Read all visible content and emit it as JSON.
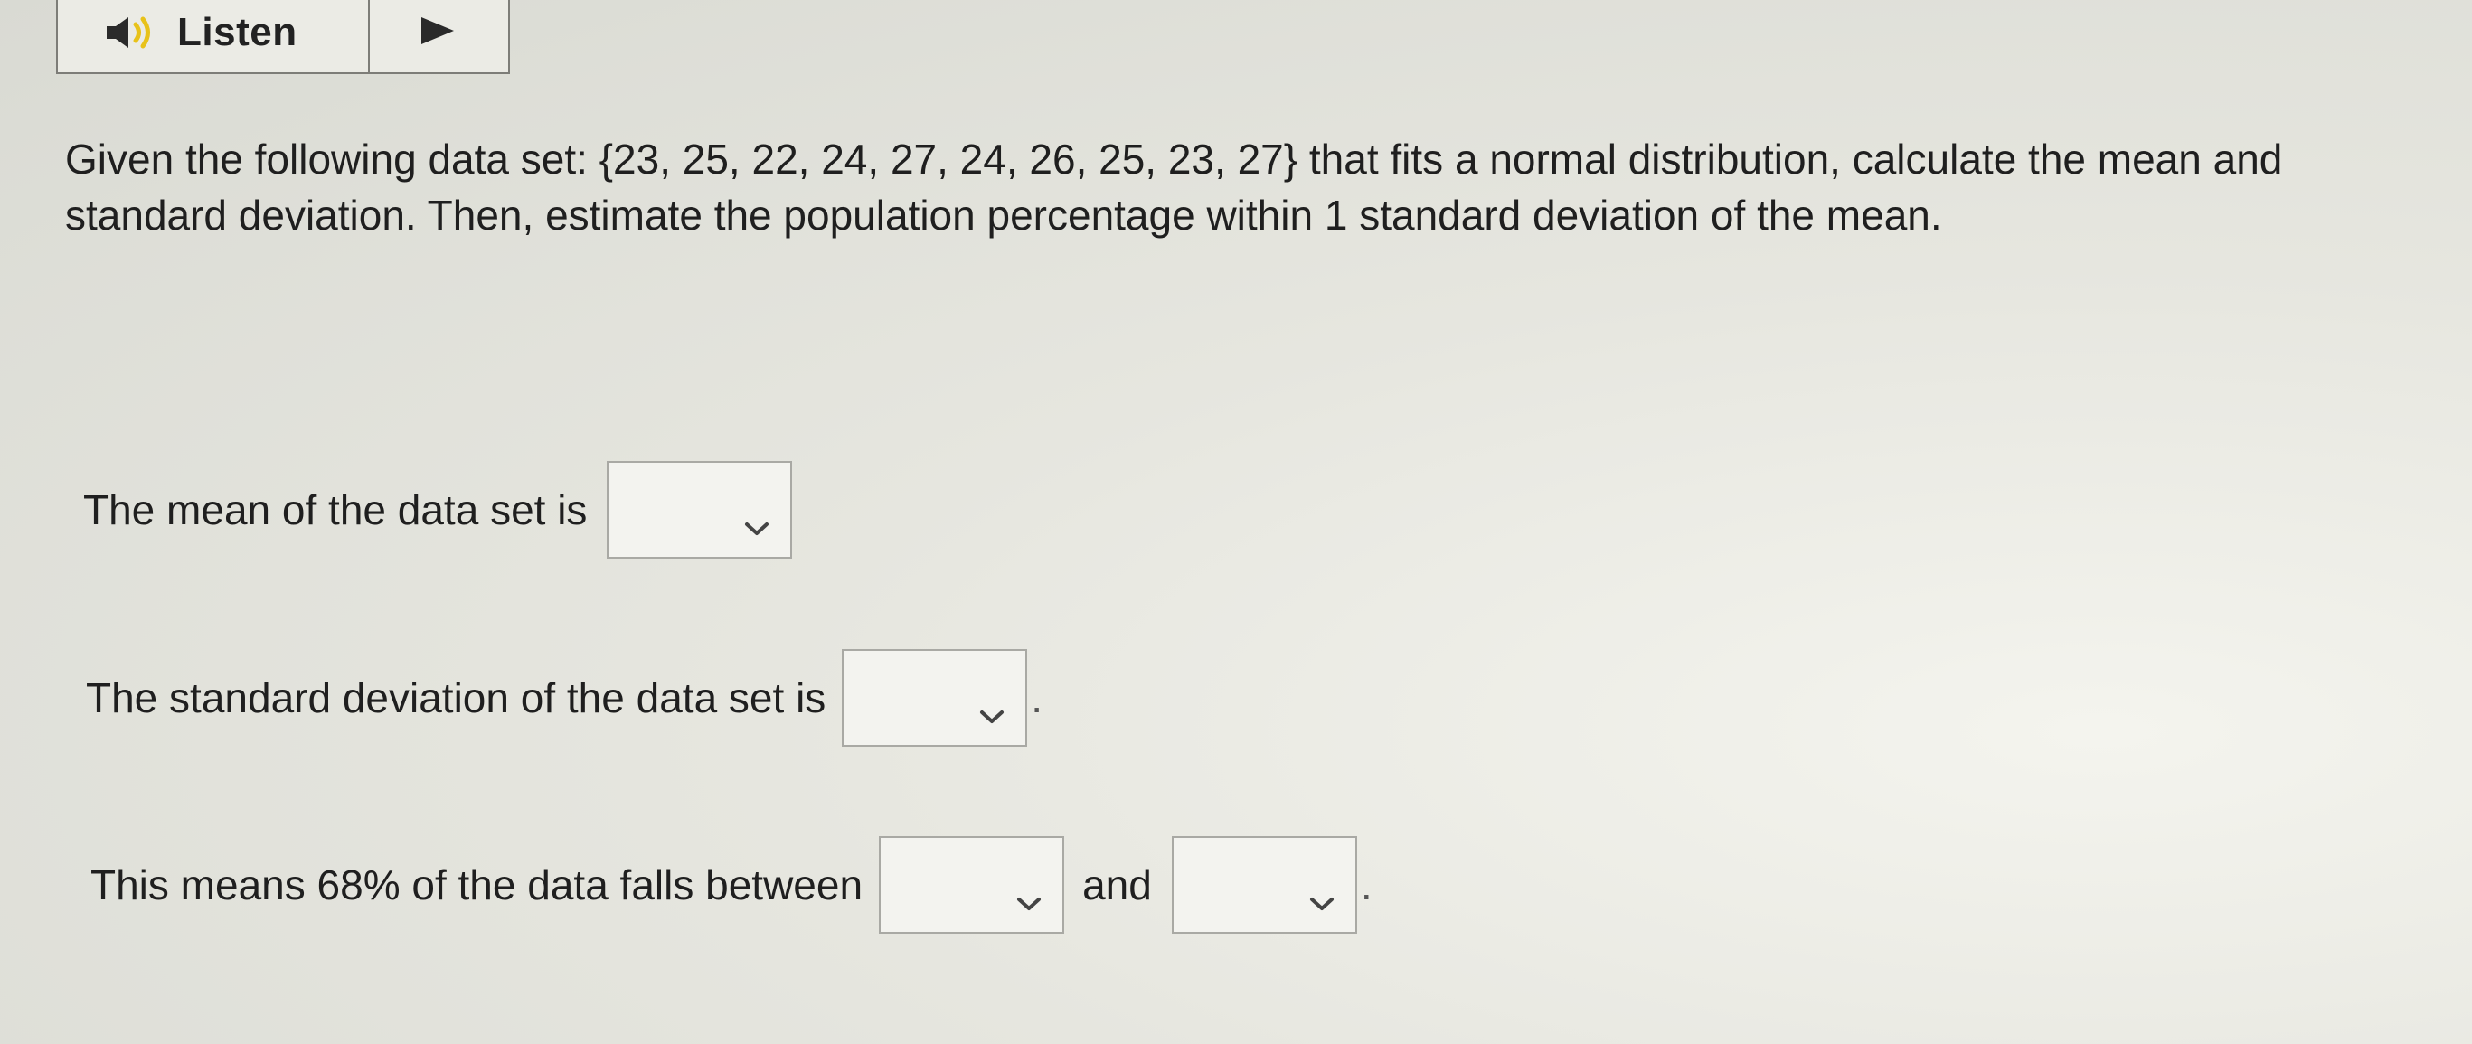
{
  "toolbar": {
    "listen_label": "Listen",
    "speaker_icon": "speaker-icon",
    "play_icon": "play-icon"
  },
  "question": {
    "text": "Given the following data set: {23, 25, 22, 24, 27, 24, 26, 25, 23, 27} that fits a normal distribution, calculate the mean and standard deviation. Then, estimate the population percentage within 1 standard deviation of the mean."
  },
  "answers": {
    "mean_prompt": "The mean of the data set is",
    "sd_prompt": "The standard deviation of the data set is",
    "range_prompt": "This means 68% of the data falls between",
    "and_text": "and",
    "period": ".",
    "mean_value": "",
    "sd_value": "",
    "lower_value": "",
    "upper_value": ""
  }
}
